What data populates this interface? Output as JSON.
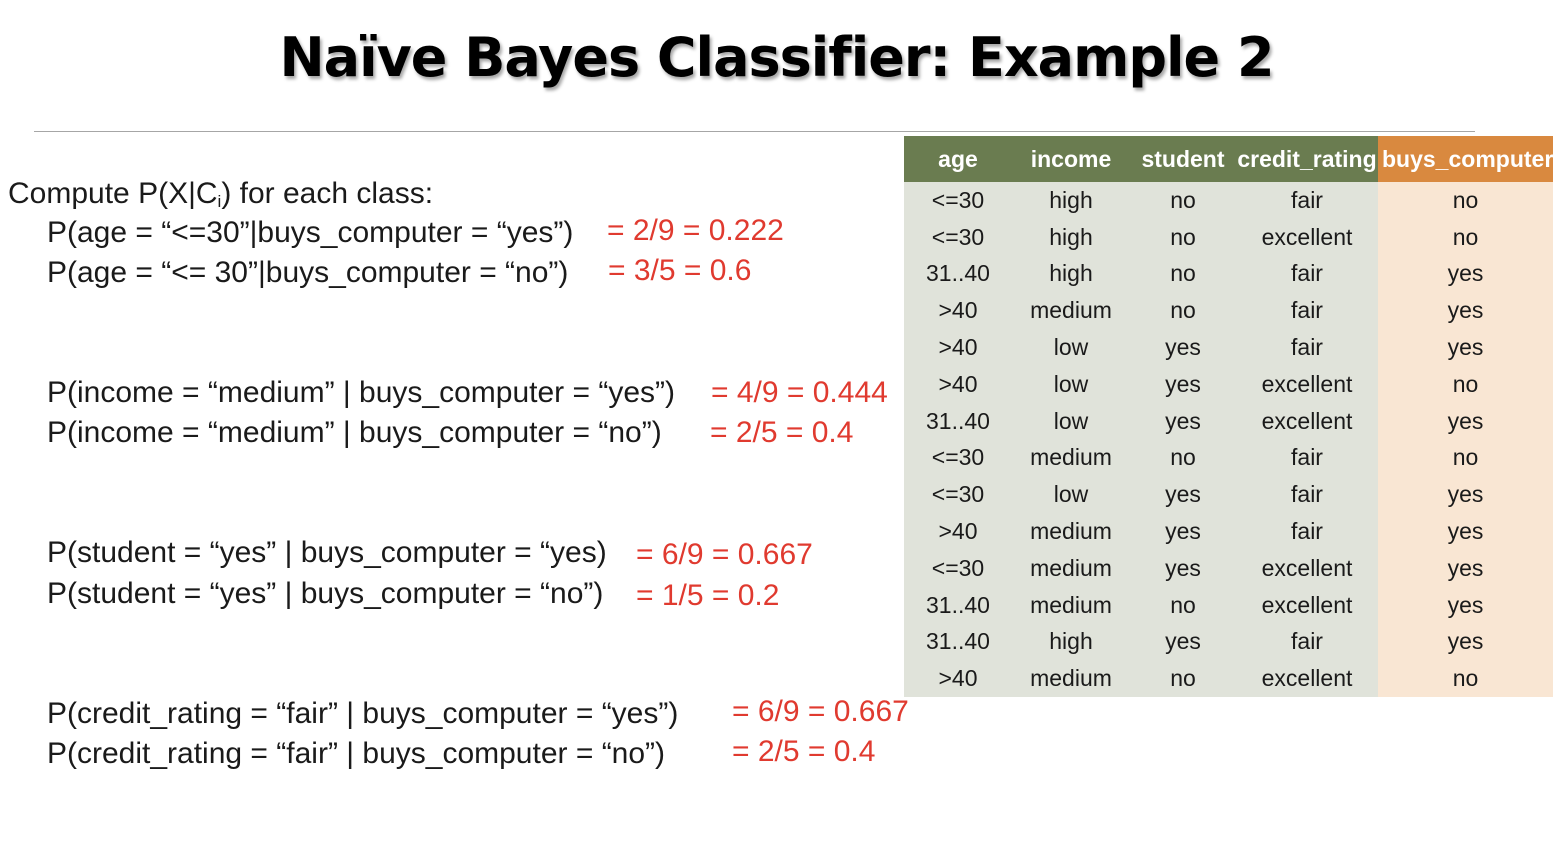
{
  "title": "Naïve Bayes Classifier: Example 2",
  "intro": {
    "before_sub": "Compute P(X|C",
    "sub": "i",
    "after_sub": ") for each class:"
  },
  "probabilities": [
    {
      "expr": "P(age = “<=30”|buys_computer = “yes”)",
      "result": "= 2/9 = 0.222"
    },
    {
      "expr": "P(age = “<= 30”|buys_computer = “no”)",
      "result": "= 3/5 = 0.6"
    },
    {
      "expr": "P(income = “medium” | buys_computer = “yes”)",
      "result": "= 4/9 = 0.444"
    },
    {
      "expr": "P(income = “medium” | buys_computer = “no”)",
      "result": "= 2/5 = 0.4"
    },
    {
      "expr": "P(student = “yes” | buys_computer = “yes)",
      "result": "= 6/9 = 0.667"
    },
    {
      "expr": "P(student = “yes” | buys_computer = “no”)",
      "result": "= 1/5 = 0.2"
    },
    {
      "expr": "P(credit_rating = “fair” | buys_computer = “yes”)",
      "result": "= 6/9 = 0.667"
    },
    {
      "expr": "P(credit_rating = “fair” | buys_computer = “no”)",
      "result": "= 2/5 = 0.4"
    }
  ],
  "table": {
    "headers": [
      "age",
      "income",
      "student",
      "credit_rating",
      "buys_computer"
    ],
    "rows": [
      [
        "<=30",
        "high",
        "no",
        "fair",
        "no"
      ],
      [
        "<=30",
        "high",
        "no",
        "excellent",
        "no"
      ],
      [
        "31..40",
        "high",
        "no",
        "fair",
        "yes"
      ],
      [
        ">40",
        "medium",
        "no",
        "fair",
        "yes"
      ],
      [
        ">40",
        "low",
        "yes",
        "fair",
        "yes"
      ],
      [
        ">40",
        "low",
        "yes",
        "excellent",
        "no"
      ],
      [
        "31..40",
        "low",
        "yes",
        "excellent",
        "yes"
      ],
      [
        "<=30",
        "medium",
        "no",
        "fair",
        "no"
      ],
      [
        "<=30",
        "low",
        "yes",
        "fair",
        "yes"
      ],
      [
        ">40",
        "medium",
        "yes",
        "fair",
        "yes"
      ],
      [
        "<=30",
        "medium",
        "yes",
        "excellent",
        "yes"
      ],
      [
        "31..40",
        "medium",
        "no",
        "excellent",
        "yes"
      ],
      [
        "31..40",
        "high",
        "yes",
        "fair",
        "yes"
      ],
      [
        ">40",
        "medium",
        "no",
        "excellent",
        "no"
      ]
    ]
  },
  "colors": {
    "result_red": "#e03a2f",
    "header_green": "#6a7c50",
    "header_orange": "#d9893f",
    "cell_gray": "#e0e3da",
    "cell_peach": "#f9e6d3"
  }
}
